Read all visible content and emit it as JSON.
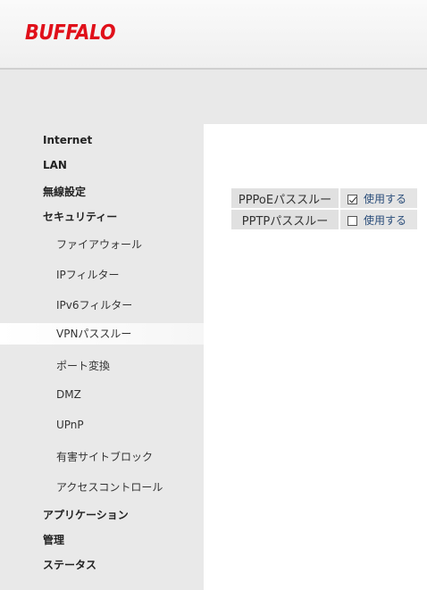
{
  "header": {
    "logo_text": "BUFFALO",
    "brand_color": "#e0101a"
  },
  "sidebar": {
    "items": [
      {
        "label": "Internet",
        "level": "top",
        "active": false
      },
      {
        "label": "LAN",
        "level": "top",
        "active": false
      },
      {
        "label": "無線設定",
        "level": "top",
        "active": false
      },
      {
        "label": "セキュリティー",
        "level": "top",
        "active": false
      },
      {
        "label": "ファイアウォール",
        "level": "sub",
        "active": false
      },
      {
        "label": "IPフィルター",
        "level": "sub",
        "active": false
      },
      {
        "label": "IPv6フィルター",
        "level": "sub",
        "active": false
      },
      {
        "label": "VPNパススルー",
        "level": "sub",
        "active": true
      },
      {
        "label": "ポート変換",
        "level": "sub",
        "active": false
      },
      {
        "label": "DMZ",
        "level": "sub",
        "active": false
      },
      {
        "label": "UPnP",
        "level": "sub",
        "active": false
      },
      {
        "label": "有害サイトブロック",
        "level": "sub",
        "active": false
      },
      {
        "label": "アクセスコントロール",
        "level": "sub",
        "active": false
      },
      {
        "label": "アプリケーション",
        "level": "top",
        "active": false
      },
      {
        "label": "管理",
        "level": "top",
        "active": false
      },
      {
        "label": "ステータス",
        "level": "top",
        "active": false
      }
    ]
  },
  "main": {
    "options": [
      {
        "label": "PPPoEパススルー",
        "checkbox_label": "使用する",
        "checked": true
      },
      {
        "label": "PPTPパススルー",
        "checkbox_label": "使用する",
        "checked": false
      }
    ]
  }
}
